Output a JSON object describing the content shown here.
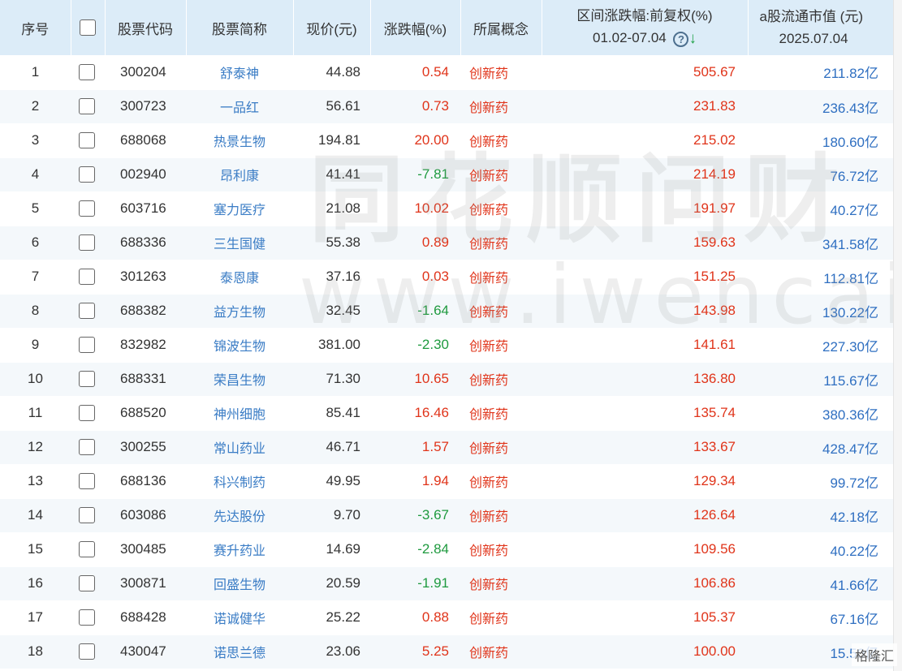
{
  "header": {
    "idx": "序号",
    "code": "股票代码",
    "name": "股票简称",
    "price": "现价(元)",
    "change": "涨跌幅(%)",
    "concept": "所属概念",
    "range_line1": "区间涨跌幅:前复权(%)",
    "range_line2": "01.02-07.04",
    "mcap_line1": "a股流通市值 (元)",
    "mcap_line2": "2025.07.04",
    "help_icon": "?",
    "sort_icon": "↓"
  },
  "colors": {
    "header_bg": "#dcecf8",
    "up": "#e0341a",
    "down": "#1f9a3f",
    "link": "#3a7cc5",
    "mcap": "#2f6fc1"
  },
  "watermark": {
    "line1": "同花顺问财",
    "line2": "www.iwencai.com"
  },
  "corner_logo": "格隆汇",
  "rows": [
    {
      "idx": "1",
      "code": "300204",
      "name": "舒泰神",
      "price": "44.88",
      "change": "0.54",
      "dir": "up",
      "concept": "创新药",
      "range": "505.67",
      "mcap": "211.82亿"
    },
    {
      "idx": "2",
      "code": "300723",
      "name": "一品红",
      "price": "56.61",
      "change": "0.73",
      "dir": "up",
      "concept": "创新药",
      "range": "231.83",
      "mcap": "236.43亿"
    },
    {
      "idx": "3",
      "code": "688068",
      "name": "热景生物",
      "price": "194.81",
      "change": "20.00",
      "dir": "up",
      "concept": "创新药",
      "range": "215.02",
      "mcap": "180.60亿"
    },
    {
      "idx": "4",
      "code": "002940",
      "name": "昂利康",
      "price": "41.41",
      "change": "-7.81",
      "dir": "down",
      "concept": "创新药",
      "range": "214.19",
      "mcap": "76.72亿"
    },
    {
      "idx": "5",
      "code": "603716",
      "name": "塞力医疗",
      "price": "21.08",
      "change": "10.02",
      "dir": "up",
      "concept": "创新药",
      "range": "191.97",
      "mcap": "40.27亿"
    },
    {
      "idx": "6",
      "code": "688336",
      "name": "三生国健",
      "price": "55.38",
      "change": "0.89",
      "dir": "up",
      "concept": "创新药",
      "range": "159.63",
      "mcap": "341.58亿"
    },
    {
      "idx": "7",
      "code": "301263",
      "name": "泰恩康",
      "price": "37.16",
      "change": "0.03",
      "dir": "up",
      "concept": "创新药",
      "range": "151.25",
      "mcap": "112.81亿"
    },
    {
      "idx": "8",
      "code": "688382",
      "name": "益方生物",
      "price": "32.45",
      "change": "-1.64",
      "dir": "down",
      "concept": "创新药",
      "range": "143.98",
      "mcap": "130.22亿"
    },
    {
      "idx": "9",
      "code": "832982",
      "name": "锦波生物",
      "price": "381.00",
      "change": "-2.30",
      "dir": "down",
      "concept": "创新药",
      "range": "141.61",
      "mcap": "227.30亿"
    },
    {
      "idx": "10",
      "code": "688331",
      "name": "荣昌生物",
      "price": "71.30",
      "change": "10.65",
      "dir": "up",
      "concept": "创新药",
      "range": "136.80",
      "mcap": "115.67亿"
    },
    {
      "idx": "11",
      "code": "688520",
      "name": "神州细胞",
      "price": "85.41",
      "change": "16.46",
      "dir": "up",
      "concept": "创新药",
      "range": "135.74",
      "mcap": "380.36亿"
    },
    {
      "idx": "12",
      "code": "300255",
      "name": "常山药业",
      "price": "46.71",
      "change": "1.57",
      "dir": "up",
      "concept": "创新药",
      "range": "133.67",
      "mcap": "428.47亿"
    },
    {
      "idx": "13",
      "code": "688136",
      "name": "科兴制药",
      "price": "49.95",
      "change": "1.94",
      "dir": "up",
      "concept": "创新药",
      "range": "129.34",
      "mcap": "99.72亿"
    },
    {
      "idx": "14",
      "code": "603086",
      "name": "先达股份",
      "price": "9.70",
      "change": "-3.67",
      "dir": "down",
      "concept": "创新药",
      "range": "126.64",
      "mcap": "42.18亿"
    },
    {
      "idx": "15",
      "code": "300485",
      "name": "赛升药业",
      "price": "14.69",
      "change": "-2.84",
      "dir": "down",
      "concept": "创新药",
      "range": "109.56",
      "mcap": "40.22亿"
    },
    {
      "idx": "16",
      "code": "300871",
      "name": "回盛生物",
      "price": "20.59",
      "change": "-1.91",
      "dir": "down",
      "concept": "创新药",
      "range": "106.86",
      "mcap": "41.66亿"
    },
    {
      "idx": "17",
      "code": "688428",
      "name": "诺诚健华",
      "price": "25.22",
      "change": "0.88",
      "dir": "up",
      "concept": "创新药",
      "range": "105.37",
      "mcap": "67.16亿"
    },
    {
      "idx": "18",
      "code": "430047",
      "name": "诺思兰德",
      "price": "23.06",
      "change": "5.25",
      "dir": "up",
      "concept": "创新药",
      "range": "100.00",
      "mcap": "15.50亿"
    }
  ]
}
